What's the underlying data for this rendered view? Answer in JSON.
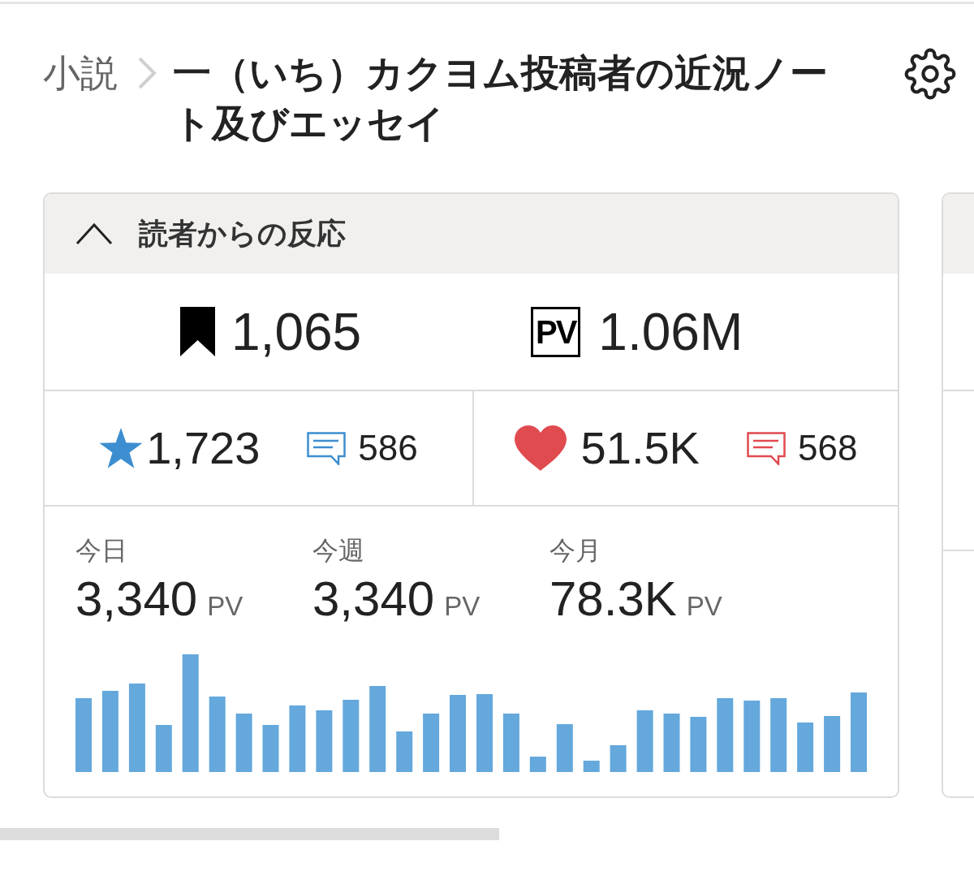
{
  "breadcrumb": {
    "parent": "小説",
    "title": "一（いち）カクヨム投稿者の近況ノート及びエッセイ"
  },
  "reactions_panel": {
    "title": "読者からの反応",
    "expanded": true,
    "totals": [
      {
        "kind": "bookmark",
        "value": "1,065"
      },
      {
        "kind": "pv",
        "badge": "PV",
        "value": "1.06M"
      }
    ],
    "ratings": [
      {
        "kind": "star",
        "value": "1,723",
        "comments": "586",
        "color": "#3d8ed0"
      },
      {
        "kind": "heart",
        "value": "51.5K",
        "comments": "568",
        "color": "#e04b50"
      }
    ],
    "periods": [
      {
        "label": "今日",
        "value": "3,340",
        "unit": "PV"
      },
      {
        "label": "今週",
        "value": "3,340",
        "unit": "PV"
      },
      {
        "label": "今月",
        "value": "78.3K",
        "unit": "PV"
      }
    ]
  }
}
